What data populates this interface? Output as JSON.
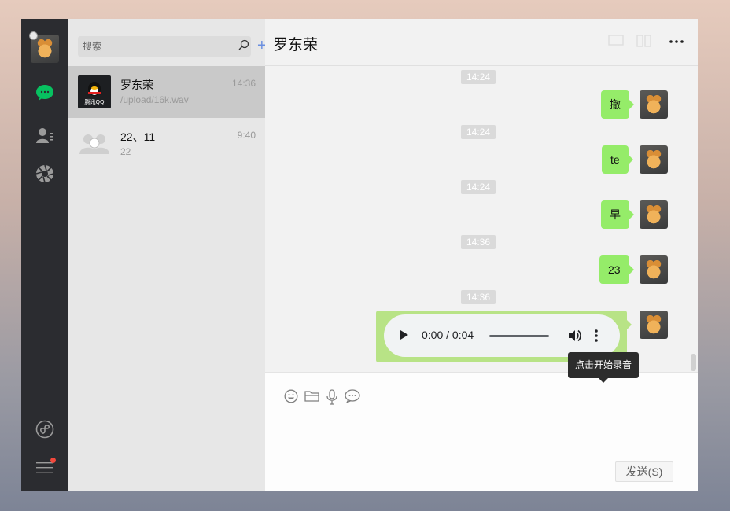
{
  "sidebar": {
    "icons": [
      "avatar",
      "chat-icon",
      "contacts-icon",
      "moments-icon",
      "mini-program-icon",
      "menu-icon"
    ],
    "accent": "#07c160",
    "badge_color": "#f2483c"
  },
  "search": {
    "placeholder": "搜索"
  },
  "conversations": [
    {
      "name": "罗东荣",
      "preview": "/upload/16k.wav",
      "time": "14:36",
      "thumb_label": "腾讯QQ",
      "active": true
    },
    {
      "name": "22、11",
      "preview": "22",
      "time": "9:40",
      "active": false
    }
  ],
  "chat": {
    "title": "罗东荣",
    "messages": [
      {
        "time": "14:24",
        "text": "撤"
      },
      {
        "time": "14:24",
        "text": "te"
      },
      {
        "time": "14:24",
        "text": "早"
      },
      {
        "time": "14:36",
        "text": "23"
      },
      {
        "time": "14:36",
        "type": "audio",
        "player_time": "0:00 / 0:04"
      }
    ]
  },
  "compose": {
    "tooltip": "点击开始录音",
    "send_label": "发送(S)",
    "tools": [
      "emoji-icon",
      "folder-icon",
      "microphone-icon",
      "chat-bubble-icon"
    ]
  },
  "colors": {
    "bubble": "#95ec69",
    "audio_bubble": "#b8e386"
  }
}
